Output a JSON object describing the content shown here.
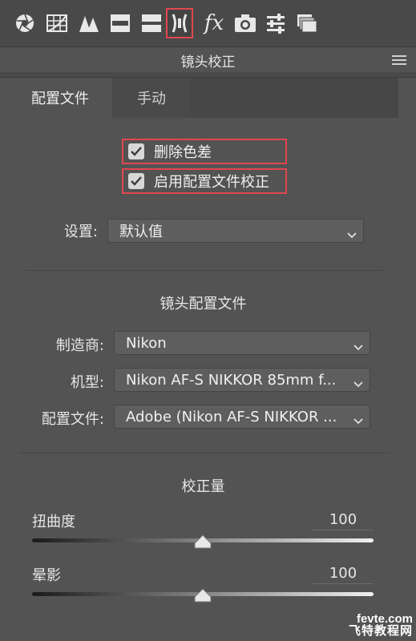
{
  "toolbar": {
    "icons": [
      "basic-aperture-icon",
      "tone-curve-grid-icon",
      "detail-triangles-icon",
      "hsl-grayscale-icon",
      "split-toning-icon",
      "lens-correction-icon",
      "effects-fx-icon",
      "camera-calibration-icon",
      "sliders-presets-icon",
      "snapshots-stack-icon"
    ],
    "fx_label": "fx",
    "active": "lens-correction-icon",
    "active_color": "#e0474f"
  },
  "panel": {
    "title": "镜头校正"
  },
  "tabs": [
    {
      "label": "配置文件",
      "active": true
    },
    {
      "label": "手动",
      "active": false
    }
  ],
  "checkboxes": [
    {
      "label": "删除色差",
      "checked": true
    },
    {
      "label": "启用配置文件校正",
      "checked": true
    }
  ],
  "setup": {
    "label": "设置:",
    "value": "默认值"
  },
  "lens_profile": {
    "title": "镜头配置文件",
    "make_label": "制造商:",
    "make_value": "Nikon",
    "model_label": "机型:",
    "model_value": "Nikon AF-S NIKKOR 85mm f...",
    "profile_label": "配置文件:",
    "profile_value": "Adobe (Nikon AF-S NIKKOR ..."
  },
  "amount": {
    "title": "校正量",
    "distortion_label": "扭曲度",
    "distortion_value": "100",
    "distortion_fraction": 0.5,
    "vignetting_label": "晕影",
    "vignetting_value": "100",
    "vignetting_fraction": 0.5
  },
  "watermark": {
    "line1": "fevte.com",
    "line2": "飞特教程网"
  }
}
